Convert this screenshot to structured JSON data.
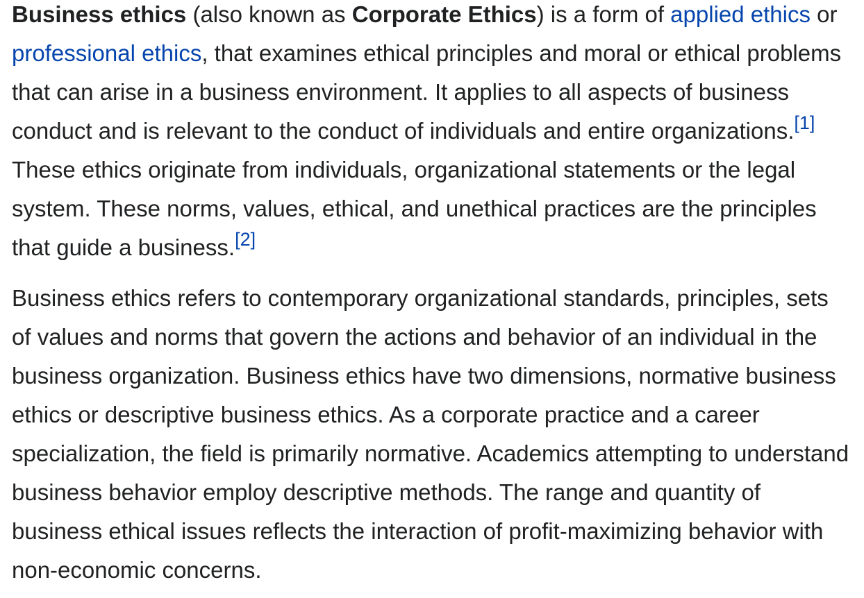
{
  "article": {
    "p1": {
      "term": "Business ethics",
      "aka_open": " (also known as ",
      "aka_term": "Corporate Ethics",
      "aka_close": ") is a form of ",
      "link_applied_ethics": "applied ethics",
      "or": " or ",
      "link_professional_ethics": "professional ethics",
      "text_a": ", that examines ethical principles and moral or ethical problems that can arise in a business environment. It applies to all aspects of business conduct and is relevant to the conduct of individuals and entire organizations.",
      "ref1": "[1]",
      "text_b": " These ethics originate from individuals, organizational statements or the legal system. These norms, values, ethical, and unethical practices are the principles that guide a business.",
      "ref2": "[2]"
    },
    "p2": {
      "text": "Business ethics refers to contemporary organizational standards, principles, sets of values and norms that govern the actions and behavior of an individual in the business organization. Business ethics have two dimensions, normative business ethics or descriptive business ethics. As a corporate practice and a career specialization, the field is primarily normative. Academics attempting to understand business behavior employ descriptive methods. The range and quantity of business ethical issues reflects the interaction of profit-maximizing behavior with non-economic concerns."
    }
  },
  "colors": {
    "text": "#202122",
    "link": "#0645ad",
    "background": "#ffffff"
  }
}
